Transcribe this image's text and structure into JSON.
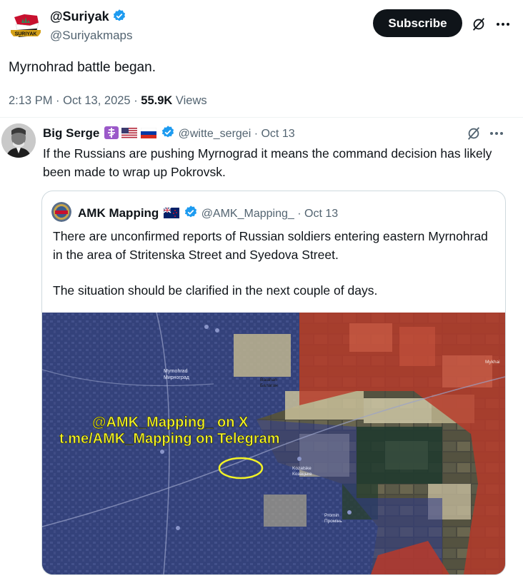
{
  "main_tweet": {
    "display_name": "@Suriyak",
    "handle": "@Suriyakmaps",
    "subscribe_label": "Subscribe",
    "text": "Myrnohrad battle began.",
    "time": "2:13 PM",
    "date": "Oct 13, 2025",
    "views_count": "55.9K",
    "views_label": "Views",
    "avatar_text": "SURIYAK"
  },
  "quote_tweet": {
    "display_name": "Big Serge",
    "handle": "@witte_sergei",
    "date": "Oct 13",
    "text": "If the Russians are pushing Myrnograd it means the command decision has likely been made to wrap up Pokrovsk."
  },
  "nested_quote": {
    "display_name": "AMK Mapping",
    "handle": "@AMK_Mapping_",
    "date": "Oct 13",
    "text_line1": "There are unconfirmed reports of Russian soldiers entering eastern Myrnohrad in the area of Stritenska Street and Syedova Street.",
    "text_line2": "The situation should be clarified in the next couple of days."
  },
  "map": {
    "watermark_line1": "@AMK_Mapping_ on X",
    "watermark_line2": "t.me/AMK_Mapping on Telegram",
    "labels": {
      "myrnohrad": "Myrnohrad",
      "myrnohrad_ua": "Мирноград",
      "balahan": "Balahan",
      "balahan_ua": "Балаган",
      "kozatske": "Kozatske",
      "kozatske_ua": "Козацьке",
      "promin": "Promin",
      "promin_ua": "Промінь",
      "mykhailivka": "Mykhai"
    }
  },
  "colors": {
    "accent_verified": "#1d9bf0",
    "text_secondary": "#536471",
    "watermark": "#f2f227",
    "front_red": "#b8392a",
    "overlay_blue": "#2d3a8c"
  }
}
